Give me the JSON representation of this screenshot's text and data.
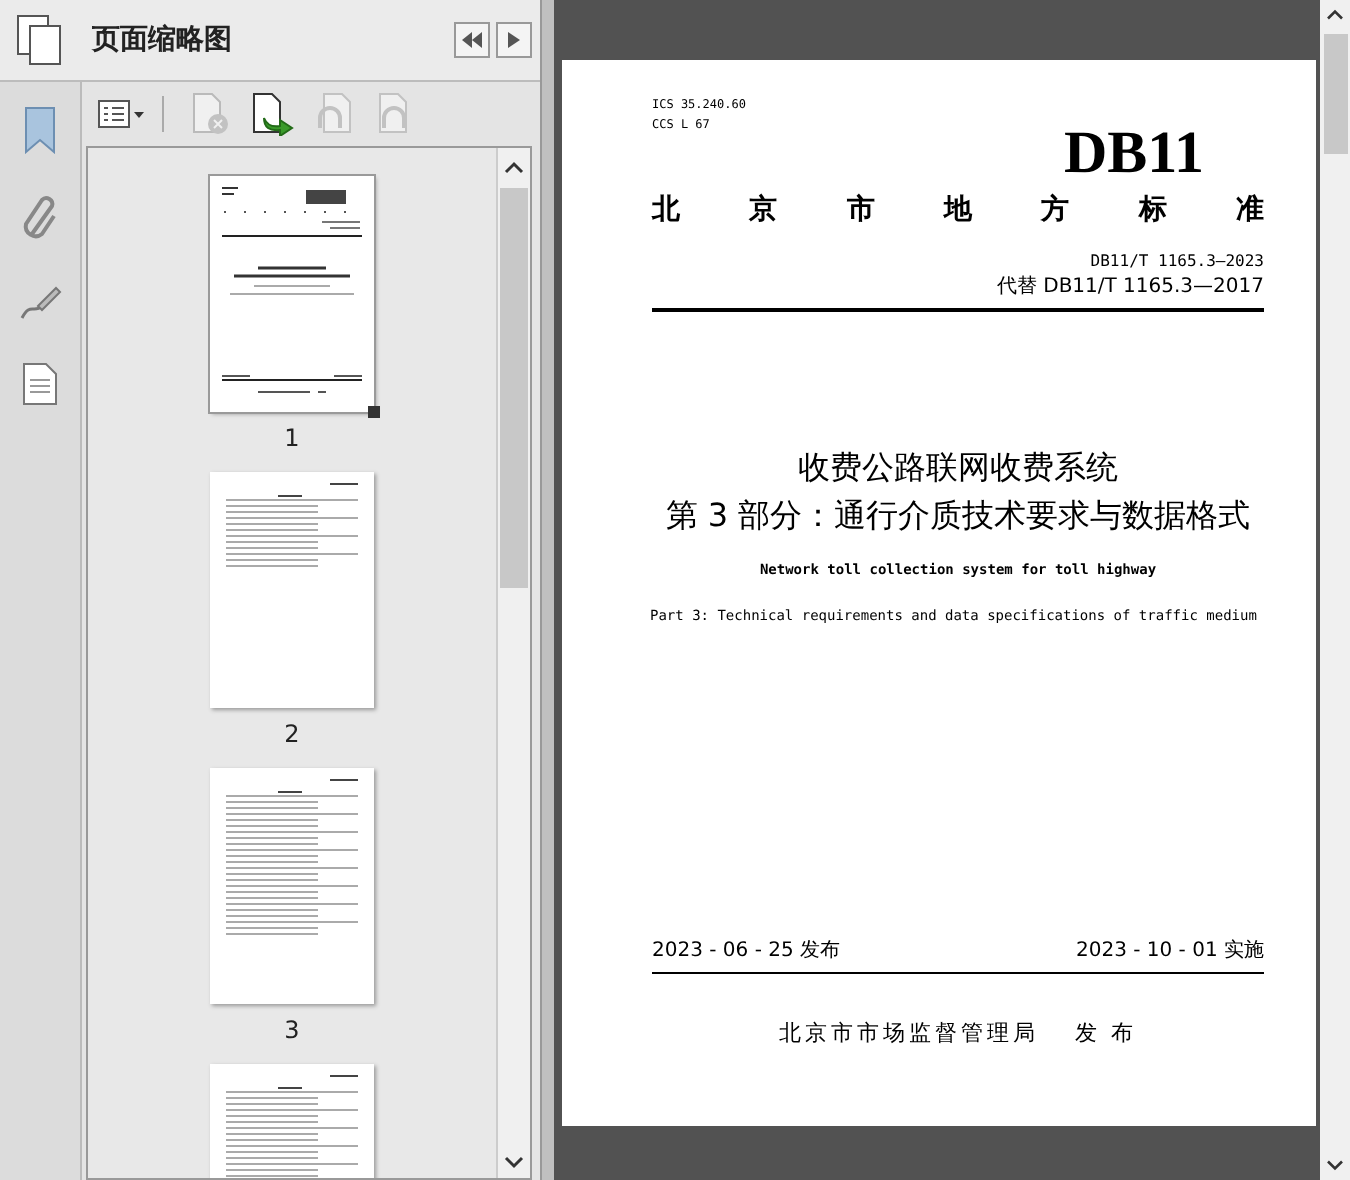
{
  "panel": {
    "title": "页面缩略图",
    "toolbar": [
      {
        "kind": "options",
        "disabled": false
      },
      {
        "kind": "delete",
        "disabled": true
      },
      {
        "kind": "insert",
        "disabled": false
      },
      {
        "kind": "undo",
        "disabled": true
      },
      {
        "kind": "redo",
        "disabled": true
      }
    ],
    "thumbnails": [
      {
        "label": "1",
        "selected": true
      },
      {
        "label": "2",
        "selected": false
      },
      {
        "label": "3",
        "selected": false
      },
      {
        "selected": false
      }
    ]
  },
  "document": {
    "ics": "ICS  35.240.60",
    "ccs": "CCS  L 67",
    "code": "DB11",
    "authority": "北京市地方标准",
    "number": "DB11/T 1165.3—2023",
    "replaces": "代替 DB11/T 1165.3—2017",
    "title": "收费公路联网收费系统",
    "subtitle": "第 3 部分：通行介质技术要求与数据格式",
    "title_en": "Network toll collection system for toll highway",
    "subtitle_en": "Part 3: Technical requirements and data specifications of traffic medium",
    "issued": "2023 - 06 - 25 发布",
    "effective": "2023 - 10 - 01 实施",
    "publisher": "北京市市场监督管理局",
    "publish_word": "发 布"
  }
}
